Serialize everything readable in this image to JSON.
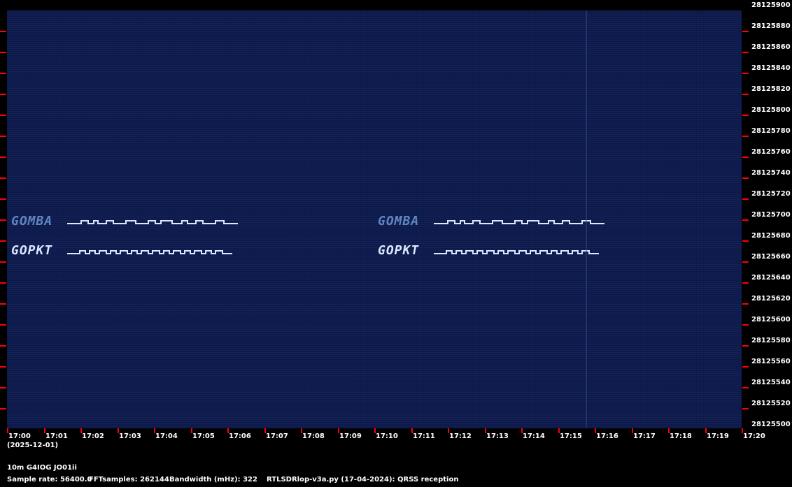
{
  "band_label": "10m G4IOG JO01ii",
  "date_label": "(2025-12-01)",
  "sample_rate": "Sample rate: 56400.0",
  "fft_samples": "FFTsamples: 262144",
  "bandwidth": "Bandwidth (mHz): 322",
  "software": "RTLSDRlop-v3a.py (17-04-2024): QRSS reception",
  "frequency_labels": [
    "28125900",
    "28125880",
    "28125860",
    "28125840",
    "28125820",
    "28125800",
    "28125780",
    "28125760",
    "28125740",
    "28125720",
    "28125700",
    "28125680",
    "28125660",
    "28125640",
    "28125620",
    "28125600",
    "28125580",
    "28125560",
    "28125540",
    "28125520",
    "28125500"
  ],
  "time_labels": [
    "17:00",
    "17:01",
    "17:02",
    "17:03",
    "17:04",
    "17:05",
    "17:06",
    "17:07",
    "17:08",
    "17:09",
    "17:10",
    "17:11",
    "17:12",
    "17:13",
    "17:14",
    "17:15",
    "17:16",
    "17:17",
    "17:18",
    "17:19",
    "17:20"
  ],
  "signals": {
    "call1": "GOMBA",
    "call2": "GOPKT"
  },
  "colors": {
    "background": "#000000",
    "waterfall": "#0d1a4d",
    "tick": "#ff0000",
    "signal_bright": "#dbe6ff",
    "signal_dim": "#5f86c4"
  }
}
